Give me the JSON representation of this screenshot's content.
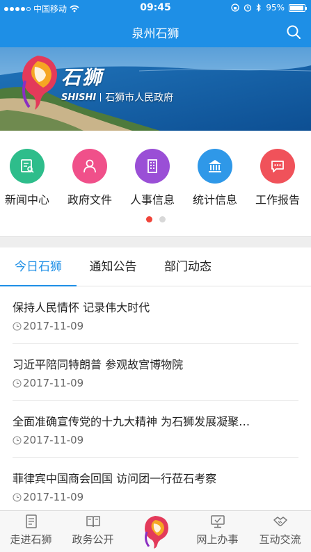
{
  "status_bar": {
    "carrier": "中国移动",
    "time": "09:45",
    "battery": "95%",
    "battery_level": 0.95
  },
  "header": {
    "title": "泉州石狮"
  },
  "banner": {
    "brand_cn": "石狮",
    "brand_en": "SHISHI",
    "gov_name": "石狮市人民政府"
  },
  "quick_menu": [
    {
      "label": "新闻中心",
      "icon": "news-icon",
      "color": "#2ebd8b"
    },
    {
      "label": "政府文件",
      "icon": "person-icon",
      "color": "#f0508a"
    },
    {
      "label": "人事信息",
      "icon": "building-icon",
      "color": "#9a4fd6"
    },
    {
      "label": "统计信息",
      "icon": "institution-icon",
      "color": "#2f98e8"
    },
    {
      "label": "工作报告",
      "icon": "chat-icon",
      "color": "#f0525a"
    }
  ],
  "pager": {
    "pages": 2,
    "active": 1
  },
  "tabs": [
    {
      "label": "今日石狮",
      "active": true
    },
    {
      "label": "通知公告",
      "active": false
    },
    {
      "label": "部门动态",
      "active": false
    }
  ],
  "news": [
    {
      "title": "保持人民情怀 记录伟大时代",
      "date": "2017-11-09"
    },
    {
      "title": "习近平陪同特朗普 参观故宫博物院",
      "date": "2017-11-09"
    },
    {
      "title": "全面准确宣传党的十九大精神 为石狮发展凝聚…",
      "date": "2017-11-09"
    },
    {
      "title": "菲律宾中国商会回国 访问团一行莅石考察",
      "date": "2017-11-09"
    }
  ],
  "tabbar": [
    {
      "label": "走进石狮",
      "icon": "document-icon"
    },
    {
      "label": "政务公开",
      "icon": "book-icon"
    },
    {
      "label": "",
      "icon": "shishi-logo-icon"
    },
    {
      "label": "网上办事",
      "icon": "monitor-icon"
    },
    {
      "label": "互动交流",
      "icon": "handshake-icon"
    }
  ],
  "colors": {
    "primary": "#1e8fe6",
    "active_dot": "#f0443a",
    "tabbar_bg": "#f7f7f7"
  }
}
